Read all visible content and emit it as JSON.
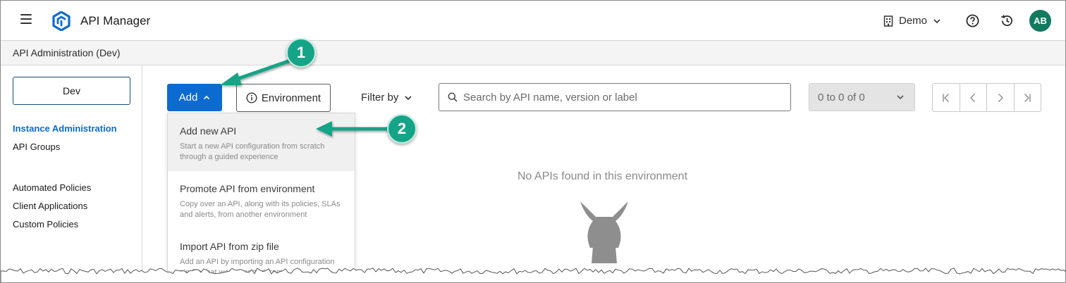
{
  "header": {
    "app_title": "API Manager",
    "org_label": "Demo",
    "avatar_initials": "AB",
    "icons": [
      "menu-icon",
      "anypoint-logo-icon",
      "building-icon",
      "chevron-down-icon",
      "help-icon",
      "history-icon"
    ]
  },
  "breadcrumb": {
    "title": "API Administration (Dev)"
  },
  "sidebar": {
    "environment_button": "Dev",
    "items": [
      {
        "label": "Instance Administration",
        "active": true
      },
      {
        "label": "API Groups",
        "active": false
      },
      {
        "label": "Automated Policies",
        "active": false
      },
      {
        "label": "Client Applications",
        "active": false
      },
      {
        "label": "Custom Policies",
        "active": false
      }
    ]
  },
  "toolbar": {
    "add_label": "Add",
    "environment_label": "Environment",
    "filter_label": "Filter by",
    "search_placeholder": "Search by API name, version or label",
    "range_label": "0 to 0 of 0"
  },
  "add_menu": {
    "items": [
      {
        "title": "Add new API",
        "description": "Start a new API configuration from scratch through a guided experience",
        "highlighted": true
      },
      {
        "title": "Promote API from environment",
        "description": "Copy over an API, along with its policies, SLAs and alerts, from another environment",
        "highlighted": false
      },
      {
        "title": "Import API from zip file",
        "description": "Add an API by importing an API configuration zip file that was exported from",
        "highlighted": false
      }
    ]
  },
  "empty_state": {
    "message": "No APIs found in this environment"
  },
  "annotations": {
    "step1": "1",
    "step2": "2",
    "color": "#15a487"
  },
  "colors": {
    "primary": "#0b6bd1",
    "active_nav": "#0b6bcb",
    "avatar": "#127a5f"
  }
}
